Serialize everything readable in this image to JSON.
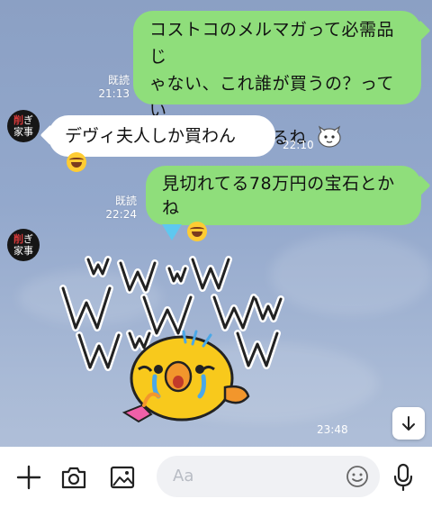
{
  "messages": [
    {
      "from": "me",
      "text_lines": [
        "コストコのメルマガって必需品じ",
        "ゃない、これ誰が買うの？ってい",
        "うの多くてウケるね"
      ],
      "read": "既読",
      "time": "21:13"
    },
    {
      "from": "other",
      "text": "デヴィ夫人しか買わん",
      "emoji": "rolling-laughing",
      "time": "22:10"
    },
    {
      "from": "me",
      "text_lines": [
        "見切れてる78万円の宝石とかね"
      ],
      "read": "既読",
      "time": "22:24"
    },
    {
      "from": "other",
      "type": "sticker",
      "sticker": "Sally chick crying with WWW",
      "time": "23:48"
    }
  ],
  "avatar": {
    "line1_red": "削",
    "line1": "ぎ",
    "line2": "家事"
  },
  "composer": {
    "placeholder": "Aa"
  },
  "icons": [
    "plus-icon",
    "camera-icon",
    "image-icon",
    "emoji-icon",
    "mic-icon",
    "arrow-down-icon"
  ],
  "colors": {
    "outgoing": "#8fde7b",
    "incoming": "#ffffff",
    "background": "#93a8cc"
  }
}
